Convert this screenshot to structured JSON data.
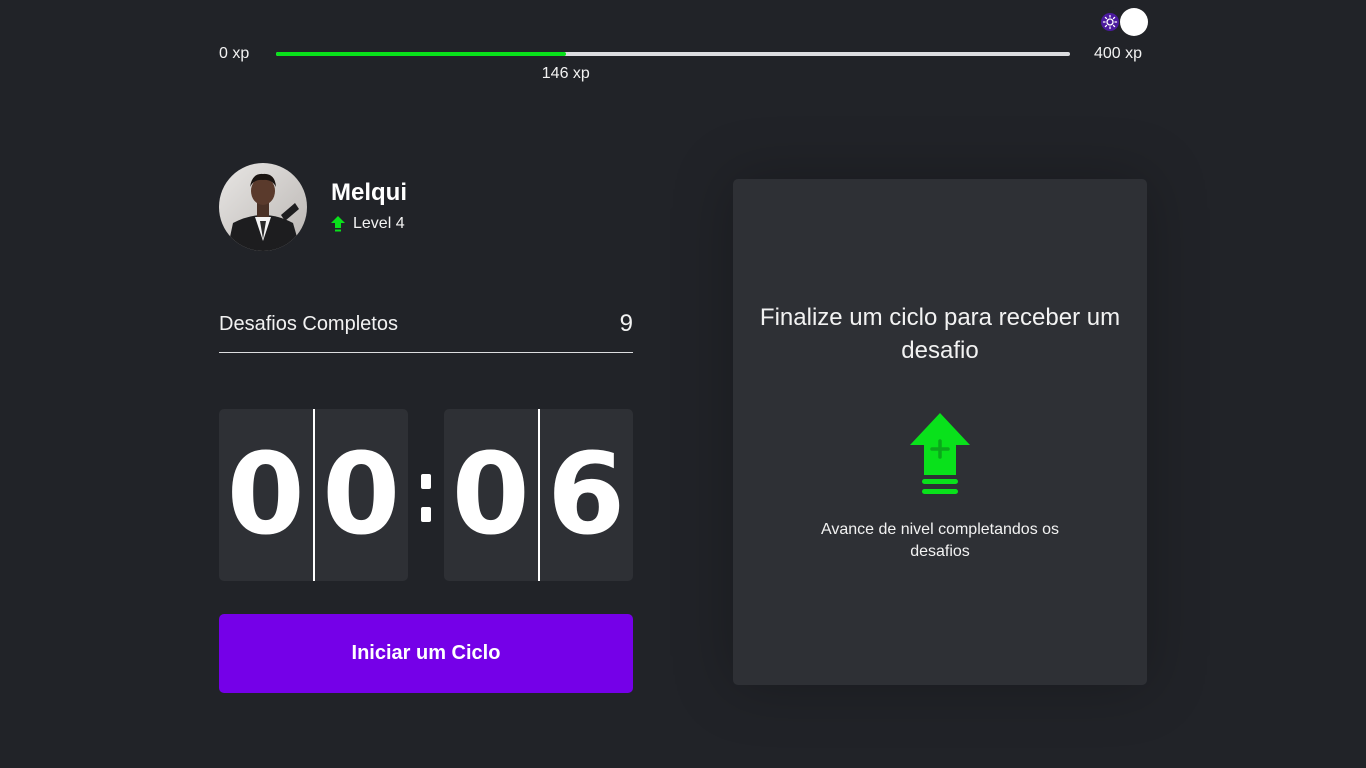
{
  "theme_toggle": {
    "icon": "sun-icon",
    "state": "dark"
  },
  "experience_bar": {
    "min_label": "0 xp",
    "max_label": "400 xp",
    "current_label": "146 xp",
    "current_xp": 146,
    "max_xp": 400,
    "fill_color": "#09e11b"
  },
  "profile": {
    "name": "Melqui",
    "level_label": "Level 4",
    "avatar": "user-photo"
  },
  "completed_challenges": {
    "label": "Desafios Completos",
    "count": "9"
  },
  "countdown": {
    "minute_left": "0",
    "minute_right": "0",
    "second_left": "0",
    "second_right": "6"
  },
  "start_button": {
    "label": "Iniciar um Ciclo",
    "color": "#7500e8"
  },
  "challenge_panel": {
    "title": "Finalize um ciclo para receber um desafio",
    "hint": "Avance de nivel completandos os desafios",
    "icon": "level-up-icon",
    "accent": "#09e11b"
  }
}
